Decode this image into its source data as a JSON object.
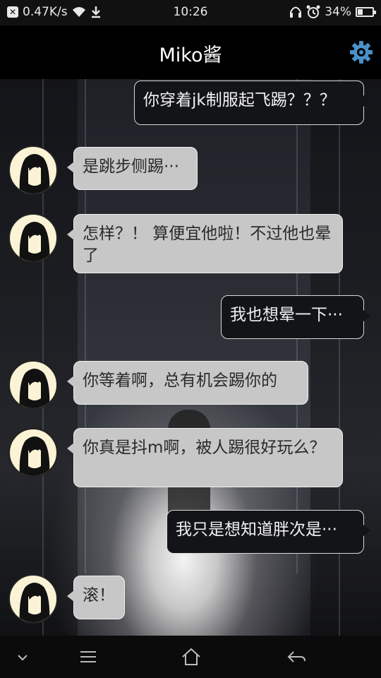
{
  "status_bar": {
    "network_speed": "0.47K/s",
    "time": "10:26",
    "battery_percent": "34%",
    "battery_level": 0.34
  },
  "header": {
    "title": "Miko酱"
  },
  "messages": [
    {
      "side": "out",
      "text": "你穿着jk制服起飞踢？？？"
    },
    {
      "side": "in",
      "text": "是跳步侧踢···"
    },
    {
      "side": "in",
      "text": "怎样？！ 算便宜他啦！不过他也晕了"
    },
    {
      "side": "out",
      "text": "我也想晕一下···"
    },
    {
      "side": "in",
      "text": "你等着啊，总有机会踢你的"
    },
    {
      "side": "in",
      "text": "你真是抖m啊，被人踢很好玩么？"
    },
    {
      "side": "out",
      "text": "我只是想知道胖次是···"
    },
    {
      "side": "in",
      "text": "滚！"
    }
  ],
  "icons": {
    "settings": "gear-icon",
    "avatar": "avatar-icon",
    "nav": [
      "chevron-down-icon",
      "menu-icon",
      "home-icon",
      "back-icon"
    ]
  },
  "colors": {
    "accent": "#4a90c8",
    "bubble_in": "#c7c7c7",
    "bubble_out": "#121417"
  }
}
